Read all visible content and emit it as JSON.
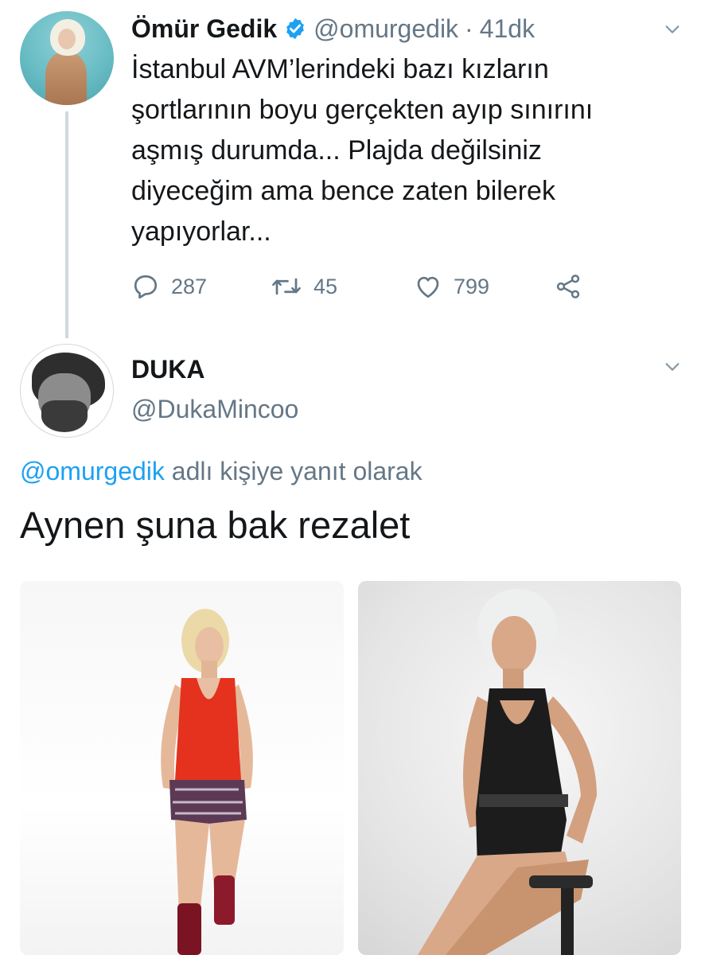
{
  "tweet1": {
    "author_name": "Ömür Gedik",
    "handle": "@omurgedik",
    "separator": "·",
    "time": "41dk",
    "text_lines": [
      "İstanbul AVM’lerindeki bazı kızların",
      "şortlarının boyu gerçekten ayıp sınırını",
      "aşmış durumda... Plajda değilsiniz",
      "diyeceğim ama bence zaten bilerek",
      "yapıyorlar..."
    ],
    "replies": "287",
    "retweets": "45",
    "likes": "799",
    "verified": true,
    "icons": [
      "reply-icon",
      "retweet-icon",
      "like-icon",
      "share-icon",
      "chevron-down-icon",
      "verified-badge-icon"
    ]
  },
  "tweet2": {
    "author_name": "DUKA",
    "handle": "@DukaMincoo",
    "reply_mention": "@omurgedik",
    "reply_suffix": " adlı kişiye yanıt olarak",
    "text": "Aynen şuna bak rezalet"
  },
  "colors": {
    "text": "#14171a",
    "secondary": "#657786",
    "link": "#1da1f2",
    "thread_line": "#cfd9de"
  }
}
